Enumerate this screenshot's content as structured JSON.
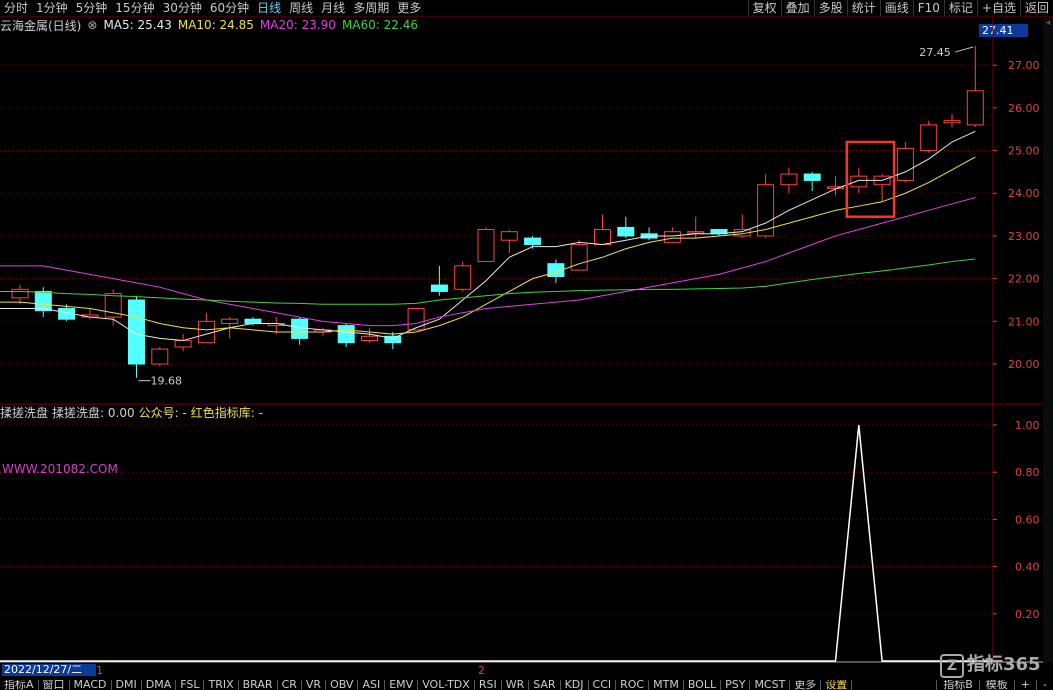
{
  "toolbar": {
    "tabs": [
      "分时",
      "1分钟",
      "5分钟",
      "15分钟",
      "30分钟",
      "60分钟",
      "日线",
      "周线",
      "月线",
      "多周期",
      "更多"
    ],
    "active": "日线",
    "right_tabs": [
      "复权",
      "叠加",
      "多股",
      "统计",
      "画线",
      "F10",
      "标记",
      "+自选",
      "返回"
    ]
  },
  "title": {
    "stock": "云海金属(日线)",
    "ma": [
      {
        "label": "MA5: 25.43",
        "color": "#e8e8e8"
      },
      {
        "label": "MA10: 24.85",
        "color": "#f0e040"
      },
      {
        "label": "MA20: 23.90",
        "color": "#e040e0"
      },
      {
        "label": "MA60: 22.46",
        "color": "#40d040"
      }
    ]
  },
  "price_box": "27.41",
  "high_label": "27.45",
  "low_label": "19.68",
  "price_axis": [
    "27.00",
    "26.00",
    "25.00",
    "24.00",
    "23.00",
    "22.00",
    "21.00",
    "20.00"
  ],
  "sub": {
    "name": "揉搓洗盘",
    "value": "揉搓洗盘: 0.00",
    "gzh": "公众号: -",
    "lib": "红色指标库: -",
    "url": "WWW.201082.COM"
  },
  "sub_axis": [
    "1.00",
    "0.80",
    "0.60",
    "0.40",
    "0.20"
  ],
  "bottom": {
    "date": "2022/12/27/二",
    "marks": [
      "1",
      "2"
    ],
    "indicators": [
      "指标A",
      "窗口",
      "MACD",
      "DMI",
      "DMA",
      "FSL",
      "TRIX",
      "BRAR",
      "CR",
      "VR",
      "OBV",
      "ASI",
      "EMV",
      "VOL-TDX",
      "RSI",
      "WR",
      "SAR",
      "KDJ",
      "CCI",
      "ROC",
      "MTM",
      "BOLL",
      "PSY",
      "MCST",
      "更多",
      "设置"
    ],
    "selected": "设置",
    "right": [
      "指标B",
      "模板",
      "+",
      "-"
    ]
  },
  "logo": "指标365",
  "colors": {
    "up": "#ff4040",
    "down": "#54ffff",
    "ma5": "#e8e8e8",
    "ma10": "#f0e040",
    "ma20": "#e040e0",
    "ma60": "#40d040",
    "grid": "#7a0000",
    "highlight": "#ff3030"
  },
  "chart_data": {
    "type": "candlestick",
    "y_range": [
      19.5,
      27.8
    ],
    "candles": [
      {
        "o": 21.55,
        "c": 21.75,
        "h": 21.85,
        "l": 21.4
      },
      {
        "o": 21.7,
        "c": 21.25,
        "h": 21.8,
        "l": 21.1
      },
      {
        "o": 21.3,
        "c": 21.05,
        "h": 21.4,
        "l": 21.0
      },
      {
        "o": 21.1,
        "c": 21.15,
        "h": 21.3,
        "l": 21.05
      },
      {
        "o": 21.1,
        "c": 21.65,
        "h": 21.75,
        "l": 20.9
      },
      {
        "o": 21.5,
        "c": 20.0,
        "h": 21.6,
        "l": 19.68
      },
      {
        "o": 20.0,
        "c": 20.35,
        "h": 20.4,
        "l": 19.95
      },
      {
        "o": 20.4,
        "c": 20.55,
        "h": 20.7,
        "l": 20.3
      },
      {
        "o": 20.5,
        "c": 21.0,
        "h": 21.2,
        "l": 20.5
      },
      {
        "o": 20.95,
        "c": 21.05,
        "h": 21.1,
        "l": 20.6
      },
      {
        "o": 21.05,
        "c": 20.95,
        "h": 21.1,
        "l": 20.9
      },
      {
        "o": 20.9,
        "c": 20.95,
        "h": 21.1,
        "l": 20.7
      },
      {
        "o": 21.05,
        "c": 20.6,
        "h": 21.1,
        "l": 20.45
      },
      {
        "o": 20.75,
        "c": 20.8,
        "h": 20.85,
        "l": 20.65
      },
      {
        "o": 20.9,
        "c": 20.5,
        "h": 20.95,
        "l": 20.4
      },
      {
        "o": 20.55,
        "c": 20.65,
        "h": 20.85,
        "l": 20.5
      },
      {
        "o": 20.65,
        "c": 20.5,
        "h": 20.75,
        "l": 20.35
      },
      {
        "o": 20.8,
        "c": 21.3,
        "h": 21.3,
        "l": 20.8
      },
      {
        "o": 21.85,
        "c": 21.7,
        "h": 22.3,
        "l": 21.6
      },
      {
        "o": 21.75,
        "c": 22.3,
        "h": 22.4,
        "l": 21.7
      },
      {
        "o": 22.4,
        "c": 23.15,
        "h": 23.2,
        "l": 22.4
      },
      {
        "o": 22.9,
        "c": 23.1,
        "h": 23.15,
        "l": 22.6
      },
      {
        "o": 22.95,
        "c": 22.8,
        "h": 23.0,
        "l": 22.7
      },
      {
        "o": 22.35,
        "c": 22.05,
        "h": 22.45,
        "l": 21.9
      },
      {
        "o": 22.2,
        "c": 22.8,
        "h": 22.9,
        "l": 22.2
      },
      {
        "o": 22.8,
        "c": 23.15,
        "h": 23.5,
        "l": 22.8
      },
      {
        "o": 23.2,
        "c": 23.0,
        "h": 23.45,
        "l": 22.95
      },
      {
        "o": 23.05,
        "c": 22.95,
        "h": 23.2,
        "l": 22.9
      },
      {
        "o": 22.85,
        "c": 23.1,
        "h": 23.2,
        "l": 22.85
      },
      {
        "o": 23.1,
        "c": 23.1,
        "h": 23.45,
        "l": 22.95
      },
      {
        "o": 23.15,
        "c": 23.05,
        "h": 23.15,
        "l": 23.0
      },
      {
        "o": 23.0,
        "c": 23.15,
        "h": 23.5,
        "l": 22.95
      },
      {
        "o": 23.0,
        "c": 24.2,
        "h": 24.45,
        "l": 22.95
      },
      {
        "o": 24.2,
        "c": 24.45,
        "h": 24.6,
        "l": 24.0
      },
      {
        "o": 24.45,
        "c": 24.3,
        "h": 24.5,
        "l": 24.05
      },
      {
        "o": 24.15,
        "c": 24.15,
        "h": 24.4,
        "l": 23.95
      },
      {
        "o": 24.15,
        "c": 24.4,
        "h": 24.6,
        "l": 24.0
      },
      {
        "o": 24.2,
        "c": 24.4,
        "h": 24.45,
        "l": 23.8
      },
      {
        "o": 24.3,
        "c": 25.05,
        "h": 25.2,
        "l": 24.25
      },
      {
        "o": 25.0,
        "c": 25.6,
        "h": 25.7,
        "l": 24.95
      },
      {
        "o": 25.65,
        "c": 25.7,
        "h": 25.85,
        "l": 25.55
      },
      {
        "o": 25.6,
        "c": 26.4,
        "h": 27.45,
        "l": 25.55
      }
    ],
    "ma5": [
      21.3,
      21.3,
      21.2,
      21.1,
      21.05,
      20.7,
      20.6,
      20.55,
      20.7,
      20.85,
      20.95,
      20.95,
      20.85,
      20.8,
      20.75,
      20.7,
      20.6,
      20.85,
      21.05,
      21.5,
      21.95,
      22.5,
      22.75,
      22.75,
      22.85,
      22.8,
      22.9,
      23.0,
      23.0,
      23.05,
      23.05,
      23.1,
      23.3,
      23.6,
      23.85,
      24.1,
      24.3,
      24.3,
      24.5,
      24.8,
      25.2,
      25.45
    ],
    "ma10": [
      21.45,
      21.4,
      21.35,
      21.3,
      21.2,
      21.1,
      20.95,
      20.85,
      20.8,
      20.85,
      20.8,
      20.75,
      20.75,
      20.75,
      20.8,
      20.75,
      20.7,
      20.75,
      20.9,
      21.1,
      21.4,
      21.7,
      22.0,
      22.15,
      22.35,
      22.5,
      22.7,
      22.85,
      22.95,
      22.95,
      23.0,
      23.05,
      23.15,
      23.3,
      23.45,
      23.6,
      23.7,
      23.8,
      24.0,
      24.25,
      24.55,
      24.85
    ],
    "ma20": [
      22.3,
      22.3,
      22.2,
      22.1,
      22.0,
      21.9,
      21.8,
      21.65,
      21.5,
      21.4,
      21.3,
      21.2,
      21.1,
      21.0,
      20.95,
      20.9,
      20.9,
      20.95,
      21.1,
      21.2,
      21.3,
      21.35,
      21.4,
      21.45,
      21.5,
      21.6,
      21.7,
      21.8,
      21.9,
      22.0,
      22.1,
      22.25,
      22.4,
      22.6,
      22.8,
      23.0,
      23.15,
      23.3,
      23.45,
      23.6,
      23.75,
      23.9
    ],
    "ma60": [
      21.7,
      21.68,
      21.65,
      21.63,
      21.6,
      21.58,
      21.55,
      21.52,
      21.5,
      21.47,
      21.45,
      21.43,
      21.42,
      21.4,
      21.4,
      21.4,
      21.4,
      21.42,
      21.5,
      21.55,
      21.6,
      21.65,
      21.68,
      21.7,
      21.72,
      21.73,
      21.74,
      21.75,
      21.75,
      21.76,
      21.77,
      21.78,
      21.82,
      21.9,
      21.98,
      22.05,
      22.12,
      22.18,
      22.25,
      22.32,
      22.4,
      22.46
    ],
    "signal": [
      0,
      0,
      0,
      0,
      0,
      0,
      0,
      0,
      0,
      0,
      0,
      0,
      0,
      0,
      0,
      0,
      0,
      0,
      0,
      0,
      0,
      0,
      0,
      0,
      0,
      0,
      0,
      0,
      0,
      0,
      0,
      0,
      0,
      0,
      0,
      0,
      1,
      0,
      0,
      0,
      0,
      0
    ],
    "signal_range": [
      0,
      1.0
    ],
    "highlight_candles": [
      36,
      37
    ]
  }
}
